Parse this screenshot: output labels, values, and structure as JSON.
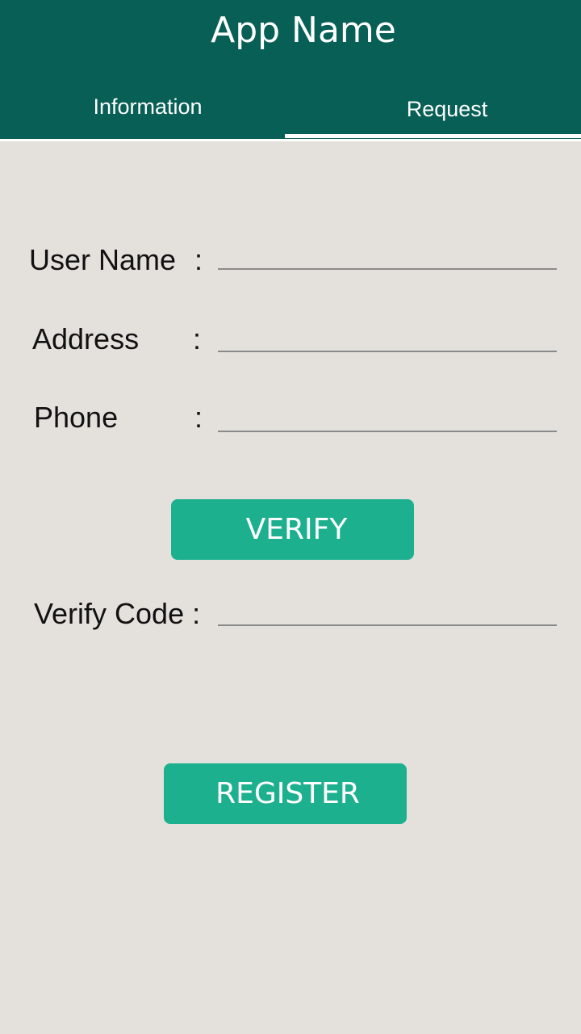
{
  "app": {
    "title": "App Name"
  },
  "tabs": [
    {
      "label": "Information",
      "selected": false
    },
    {
      "label": "Request",
      "selected": true
    }
  ],
  "colors": {
    "appbar": "#075f55",
    "accent_button": "#1db08f",
    "background": "#e4e1dc",
    "text": "#111111",
    "input_underline": "#8a8a8a"
  },
  "form": {
    "username": {
      "label": "User Name",
      "colon": ":",
      "value": ""
    },
    "address": {
      "label": "Address",
      "colon": ":",
      "value": ""
    },
    "phone": {
      "label": "Phone",
      "colon": ":",
      "value": ""
    },
    "verify_button": "VERIFY",
    "verify_code": {
      "label": "Verify Code :",
      "value": ""
    },
    "register_button": "REGISTER"
  }
}
